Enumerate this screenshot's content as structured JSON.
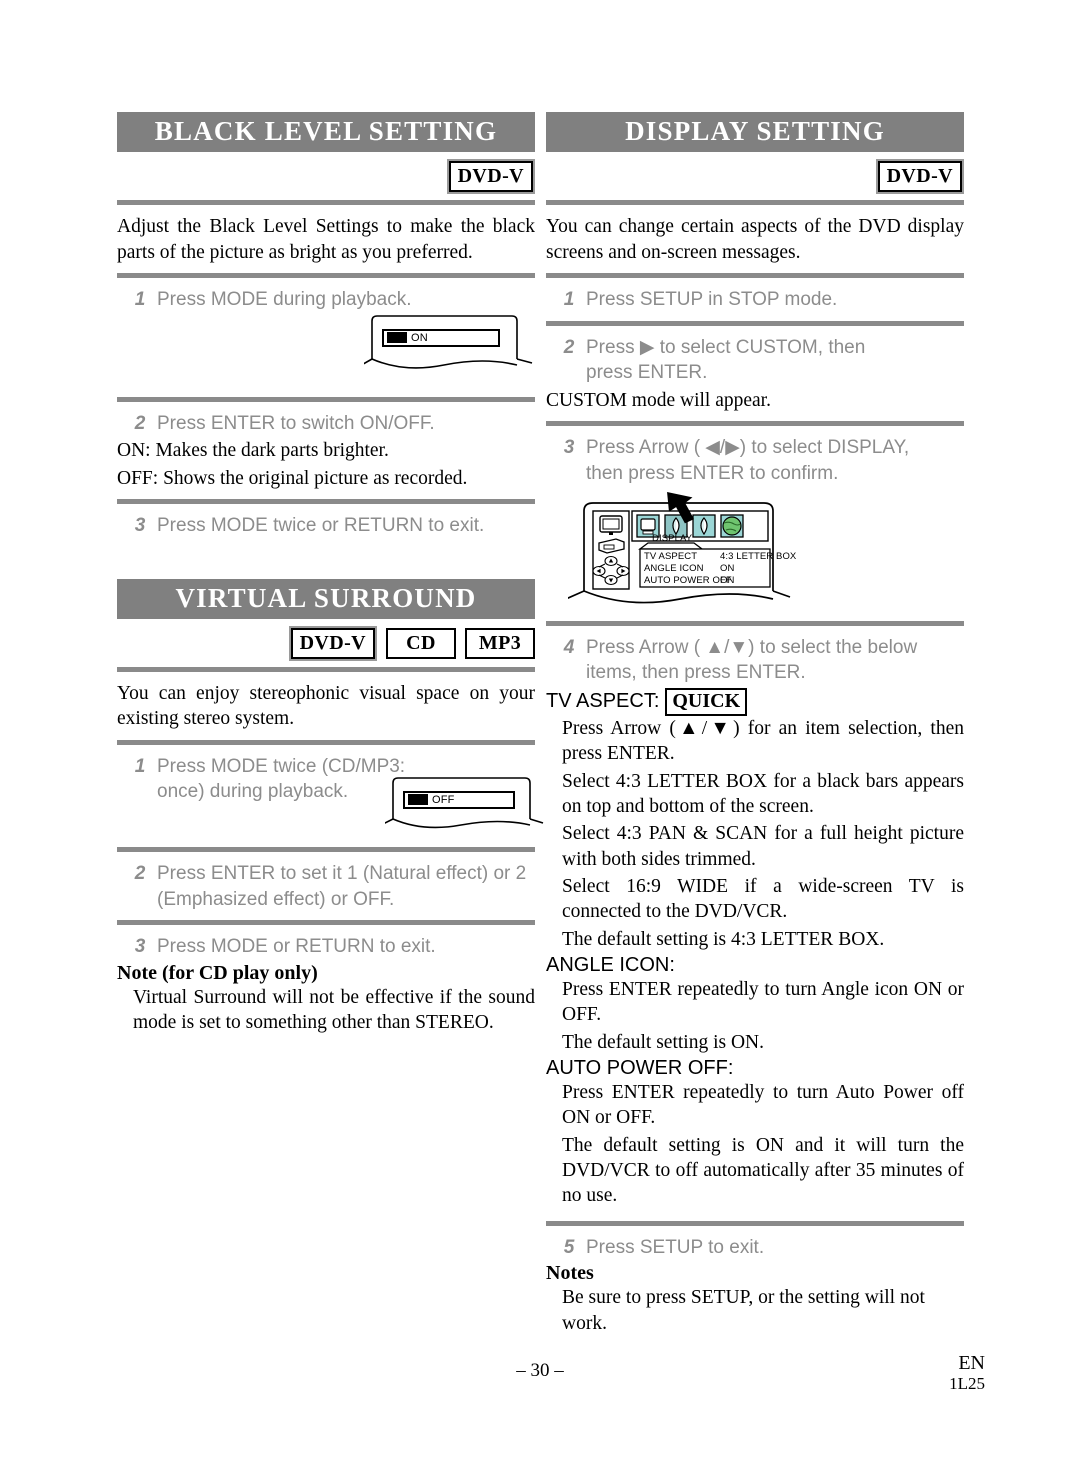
{
  "meta": {
    "page_number": "– 30 –",
    "lang_code": "EN",
    "doc_code": "1L25"
  },
  "colors": {
    "header_bar": "#808080",
    "rule": "#8a8a8a",
    "step_text": "#8c8c8c",
    "icon_teal": "#6fc8c8"
  },
  "left_column": {
    "black_level": {
      "title": "BLACK LEVEL SETTING",
      "badges": [
        "DVD-V"
      ],
      "intro": "Adjust the Black Level Settings to make the black parts of the picture as bright as you preferred.",
      "step1_num": "1",
      "step1_text": "Press MODE during playback.",
      "osd": {
        "value": "ON"
      },
      "step2_num": "2",
      "step2_text": "Press ENTER to switch ON/OFF.",
      "on_line": "ON: Makes the dark parts brighter.",
      "off_line": "OFF: Shows the original picture as recorded.",
      "step3_num": "3",
      "step3_text": "Press MODE twice or RETURN to exit."
    },
    "virtual_surround": {
      "title": "VIRTUAL SURROUND",
      "badges": [
        "DVD-V",
        "CD",
        "MP3"
      ],
      "intro": "You can enjoy stereophonic visual space on your existing stereo system.",
      "step1_num": "1",
      "step1_text": "Press MODE twice (CD/MP3: once) during playback.",
      "osd": {
        "value": "OFF"
      },
      "step2_num": "2",
      "step2_text": "Press ENTER to set it 1 (Natural effect) or 2 (Emphasized effect) or OFF.",
      "step3_num": "3",
      "step3_text": "Press MODE or RETURN to exit.",
      "note_title": "Note (for CD play only)",
      "note_body": "Virtual Surround will not be effective if the sound mode is set to something other than STEREO."
    }
  },
  "right_column": {
    "display_setting": {
      "title": "DISPLAY SETTING",
      "badges": [
        "DVD-V"
      ],
      "intro": "You can change certain aspects of the DVD display screens and on-screen messages.",
      "step1_num": "1",
      "step1_text": "Press SETUP in STOP mode.",
      "step2_num": "2",
      "step2_text": "Press ▶ to select CUSTOM, then press ENTER.",
      "step2_after": "CUSTOM mode will appear.",
      "step3_num": "3",
      "step3_text": "Press Arrow ( ◀/▶) to select DISPLAY, then press ENTER to confirm.",
      "illustration": {
        "menu_tab": "DISPLAY",
        "rows": [
          {
            "label": "TV ASPECT",
            "value": "4:3 LETTER BOX"
          },
          {
            "label": "ANGLE ICON",
            "value": "ON"
          },
          {
            "label": "AUTO POWER OFF",
            "value": "ON"
          }
        ]
      },
      "step4_num": "4",
      "step4_text": "Press Arrow ( ▲/▼) to select the below items, then press ENTER.",
      "tv_aspect_head": "TV ASPECT:",
      "tv_aspect_badge": "QUICK",
      "tv_aspect_lines": [
        "Press Arrow (▲/▼) for an item selection, then press ENTER.",
        "Select 4:3 LETTER BOX for a black bars appears on top and bottom of the screen.",
        "Select 4:3 PAN & SCAN for a full height picture with both sides trimmed.",
        "Select 16:9 WIDE if a wide-screen TV is connected to the DVD/VCR.",
        "The default setting is 4:3 LETTER BOX."
      ],
      "angle_icon_head": "ANGLE ICON:",
      "angle_icon_lines": [
        "Press ENTER repeatedly to turn Angle icon ON or OFF.",
        "The default setting is ON."
      ],
      "auto_power_head": "AUTO POWER OFF:",
      "auto_power_lines": [
        "Press ENTER repeatedly to turn Auto Power off ON or OFF.",
        "The default setting is ON and it will turn the DVD/VCR to off automatically after 35 minutes of no use."
      ],
      "step5_num": "5",
      "step5_text": "Press SETUP to exit.",
      "notes_title": "Notes",
      "notes_body": "Be sure to press SETUP, or the setting will not work."
    }
  }
}
